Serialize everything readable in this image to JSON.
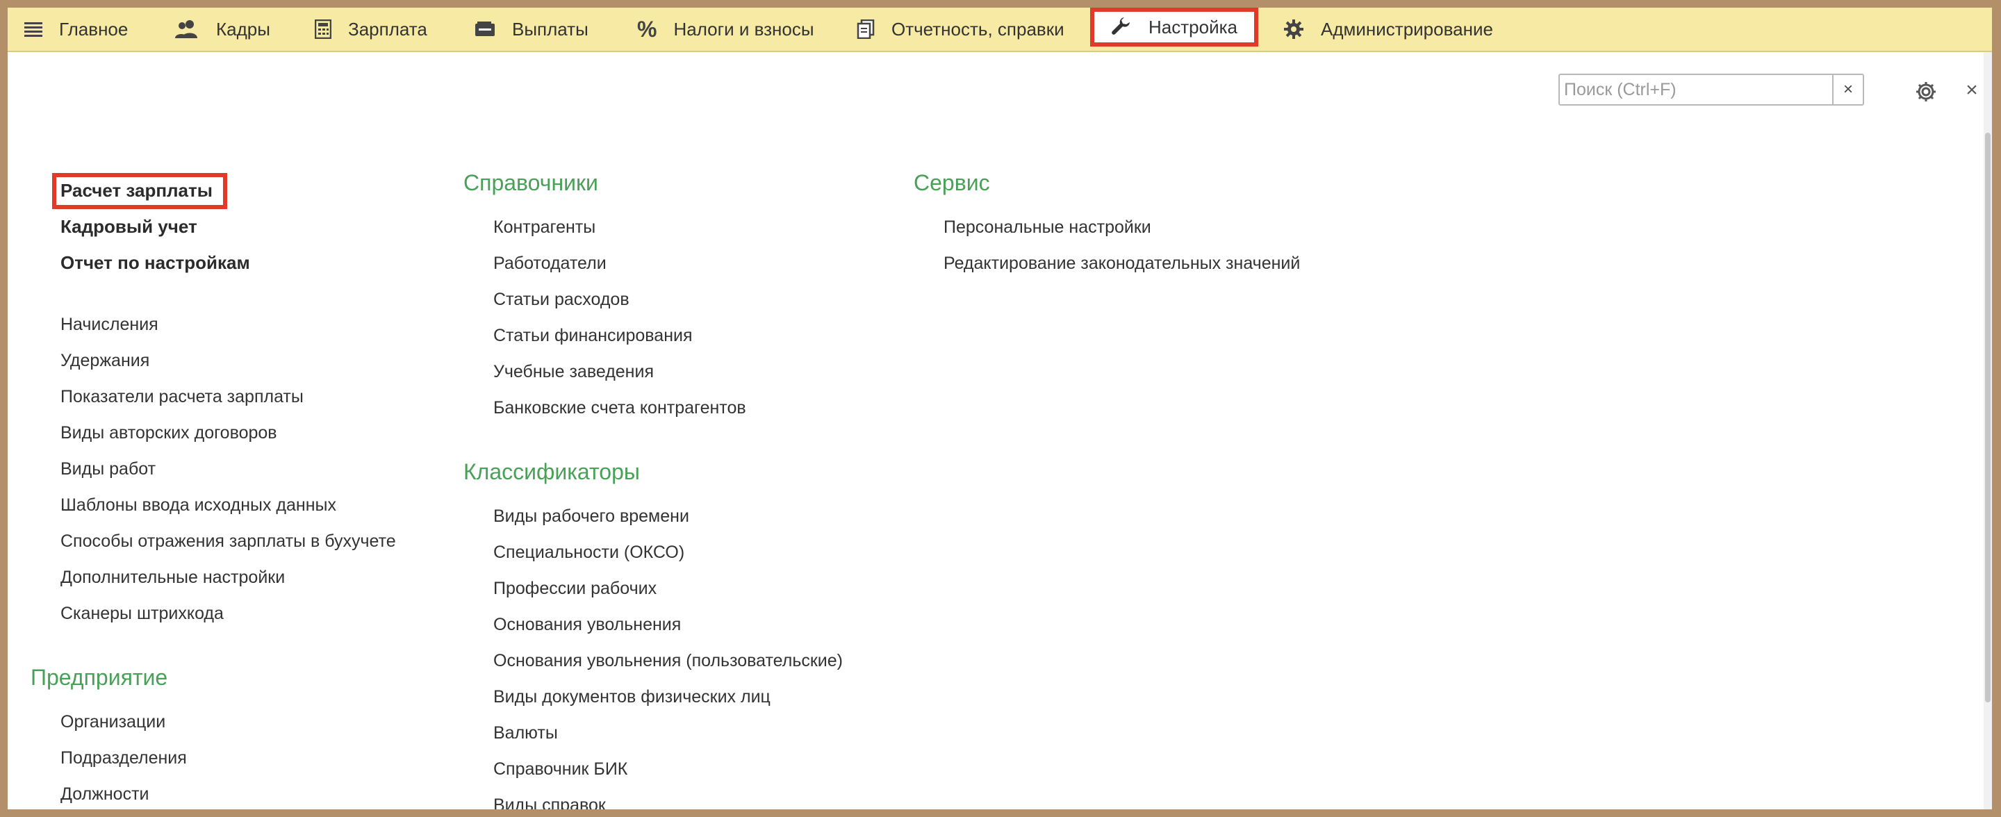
{
  "nav": [
    {
      "label": "Главное",
      "icon": "menu-icon"
    },
    {
      "label": "Кадры",
      "icon": "people-icon"
    },
    {
      "label": "Зарплата",
      "icon": "calculator-icon"
    },
    {
      "label": "Выплаты",
      "icon": "wallet-icon"
    },
    {
      "label": "Налоги и взносы",
      "icon": "percent-icon"
    },
    {
      "label": "Отчетность, справки",
      "icon": "documents-icon"
    },
    {
      "label": "Настройка",
      "icon": "wrench-icon",
      "active": true
    },
    {
      "label": "Администрирование",
      "icon": "gear-icon"
    }
  ],
  "search": {
    "placeholder": "Поиск (Ctrl+F)",
    "clear": "×"
  },
  "close_label": "×",
  "left": {
    "bold_items": [
      "Расчет зарплаты",
      "Кадровый учет",
      "Отчет по настройкам"
    ],
    "items": [
      "Начисления",
      "Удержания",
      "Показатели расчета зарплаты",
      "Виды авторских договоров",
      "Виды работ",
      "Шаблоны ввода исходных данных",
      "Способы отражения зарплаты в бухучете",
      "Дополнительные настройки",
      "Сканеры штрихкода"
    ],
    "enterprise": {
      "title": "Предприятие",
      "items": [
        "Организации",
        "Подразделения",
        "Должности"
      ]
    }
  },
  "middle": {
    "directories": {
      "title": "Справочники",
      "items": [
        "Контрагенты",
        "Работодатели",
        "Статьи расходов",
        "Статьи финансирования",
        "Учебные заведения",
        "Банковские счета контрагентов"
      ]
    },
    "classifiers": {
      "title": "Классификаторы",
      "items": [
        "Виды рабочего времени",
        "Специальности (ОКСО)",
        "Профессии рабочих",
        "Основания увольнения",
        "Основания увольнения (пользовательские)",
        "Виды документов физических лиц",
        "Валюты",
        "Справочник БИК",
        "Виды справок"
      ]
    }
  },
  "right": {
    "service": {
      "title": "Сервис",
      "items": [
        "Персональные настройки",
        "Редактирование законодательных значений"
      ]
    }
  },
  "colors": {
    "accent_green": "#4aa058",
    "topbar": "#f7eaa4",
    "highlight": "#e03a2b"
  }
}
